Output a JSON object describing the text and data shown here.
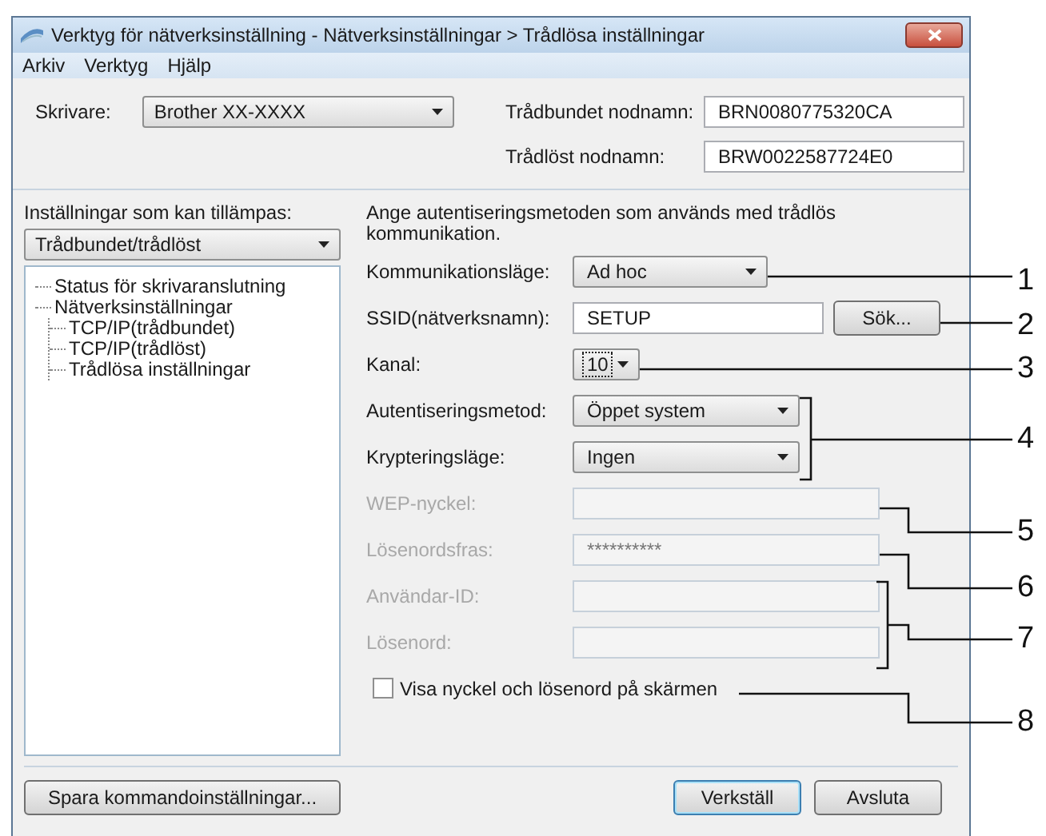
{
  "window": {
    "title": "Verktyg för nätverksinställning - Nätverksinställningar > Trådlösa inställningar"
  },
  "menu": [
    "Arkiv",
    "Verktyg",
    "Hjälp"
  ],
  "printer": {
    "label": "Skrivare:",
    "value": "Brother  XX-XXXX"
  },
  "node_names": [
    {
      "label": "Trådbundet nodnamn:",
      "value": "BRN0080775320CA"
    },
    {
      "label": "Trådlöst nodnamn:",
      "value": "BRW0022587724E0"
    }
  ],
  "settings_panel": {
    "label": "Inställningar som kan tillämpas:",
    "value": "Trådbundet/trådlöst",
    "tree": [
      {
        "label": "Status för skrivaranslutning"
      },
      {
        "label": "Nätverksinställningar",
        "children": [
          {
            "label": "TCP/IP(trådbundet)"
          },
          {
            "label": "TCP/IP(trådlöst)"
          },
          {
            "label": "Trådlösa inställningar"
          }
        ]
      }
    ]
  },
  "description": "Ange autentiseringsmetoden som används med trådlös kommunikation.",
  "form": [
    {
      "kind": "combo",
      "label": "Kommunikationsläge:",
      "value": "Ad hoc",
      "disabled": false
    },
    {
      "kind": "text",
      "label": "SSID(nätverksnamn):",
      "value": "SETUP",
      "disabled": false,
      "button": "Sök..."
    },
    {
      "kind": "combo",
      "label": "Kanal:",
      "value": "10",
      "disabled": false,
      "focused": true
    },
    {
      "kind": "combo",
      "label": "Autentiseringsmetod:",
      "value": "Öppet system",
      "disabled": false
    },
    {
      "kind": "combo",
      "label": "Krypteringsläge:",
      "value": "Ingen",
      "disabled": false
    },
    {
      "kind": "text",
      "label": "WEP-nyckel:",
      "disabled": true
    },
    {
      "kind": "text",
      "label": "Lösenordsfras:",
      "value": "**********",
      "disabled": true
    },
    {
      "kind": "text",
      "label": "Användar-ID:",
      "disabled": true
    },
    {
      "kind": "text",
      "label": "Lösenord:",
      "disabled": true
    },
    {
      "kind": "checkbox",
      "label": "Visa nyckel och lösenord på skärmen",
      "checked": false,
      "disabled": false
    }
  ],
  "save_button": "Spara kommandoinställningar...",
  "buttons": [
    {
      "label": "Verkställ",
      "default": true
    },
    {
      "label": "Avsluta",
      "default": false
    }
  ],
  "callouts": [
    "1",
    "2",
    "3",
    "4",
    "5",
    "6",
    "7",
    "8"
  ]
}
